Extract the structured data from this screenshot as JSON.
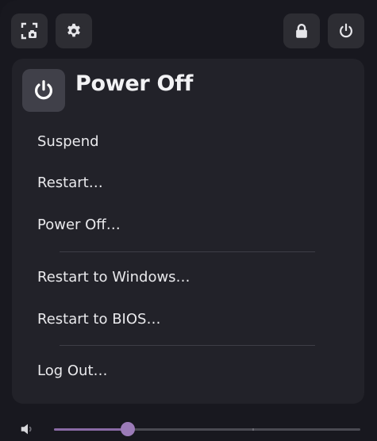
{
  "top_bar": {
    "screenshot_icon": "screenshot-icon",
    "settings_icon": "gear-icon",
    "lock_icon": "lock-icon",
    "power_icon": "power-icon"
  },
  "power_menu": {
    "title": "Power Off",
    "icon": "power-icon",
    "items": [
      {
        "label": "Suspend"
      },
      {
        "label": "Restart…"
      },
      {
        "label": "Power Off…"
      },
      {
        "label": "Restart to Windows…"
      },
      {
        "label": "Restart to BIOS…"
      },
      {
        "label": "Log Out…"
      }
    ]
  },
  "volume": {
    "icon": "speaker-icon",
    "level": 0.24,
    "level_percent": 24
  },
  "colors": {
    "accent": "#9b7bb8",
    "card_bg": "#222229",
    "panel_bg": "#18181f"
  }
}
